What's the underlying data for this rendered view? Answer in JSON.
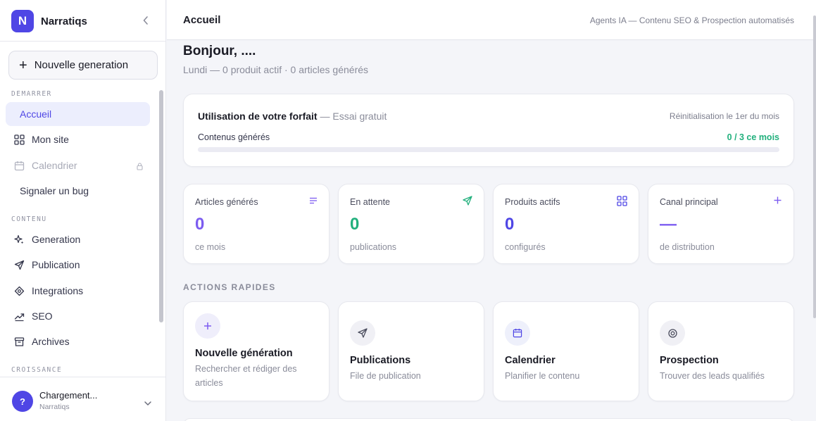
{
  "app": {
    "name": "Narratiqs",
    "logo_letter": "N",
    "accent": "#4f46e5"
  },
  "sidebar": {
    "new_button": "Nouvelle generation",
    "sections": [
      {
        "label": "DEMARRER"
      },
      {
        "label": "CONTENU"
      },
      {
        "label": "CROISSANCE"
      }
    ],
    "items": [
      {
        "label": "Accueil",
        "icon": "home",
        "active": true
      },
      {
        "label": "Mon site",
        "icon": "grid-icon"
      },
      {
        "label": "Calendrier",
        "icon": "calendar-icon",
        "locked": true
      },
      {
        "label": "Signaler un bug"
      },
      {
        "label": "Generation",
        "icon": "sparkle-icon"
      },
      {
        "label": "Publication",
        "icon": "send-icon"
      },
      {
        "label": "Integrations",
        "icon": "plug-icon"
      },
      {
        "label": "SEO",
        "icon": "trend-icon"
      },
      {
        "label": "Archives",
        "icon": "archive-icon"
      }
    ],
    "user": {
      "avatar": "?",
      "name": "Chargement...",
      "org": "Narratiqs"
    }
  },
  "header": {
    "title": "Accueil",
    "subtitle": "Agents IA — Contenu SEO & Prospection automatisés"
  },
  "main": {
    "greeting": "Bonjour, ....",
    "greeting_sub": "Lundi — 0 produit actif · 0 articles générés",
    "plan": {
      "title": "Utilisation de votre forfait",
      "plan_name": "— Essai gratuit",
      "reset": "Réinitialisation le 1er du mois",
      "label": "Contenus générés",
      "count": "0 / 3 ce mois",
      "used": 0,
      "limit": 3
    },
    "stats": [
      {
        "label": "Articles générés",
        "value": "0",
        "sub": "ce mois",
        "color": "#7c5cf0",
        "icon": "lines-icon"
      },
      {
        "label": "En attente",
        "value": "0",
        "sub": "publications",
        "color": "#22b07d",
        "icon": "send-icon"
      },
      {
        "label": "Produits actifs",
        "value": "0",
        "sub": "configurés",
        "color": "#4f46e5",
        "icon": "grid-icon"
      },
      {
        "label": "Canal principal",
        "value": "—",
        "sub": "de distribution",
        "color": "#7c5cf0",
        "icon": "plus-icon"
      }
    ],
    "actions_heading": "ACTIONS RAPIDES",
    "actions": [
      {
        "title": "Nouvelle génération",
        "desc": "Rechercher et rédiger des articles",
        "icon": "plus-icon"
      },
      {
        "title": "Publications",
        "desc": "File de publication",
        "icon": "send-icon"
      },
      {
        "title": "Calendrier",
        "desc": "Planifier le contenu",
        "icon": "calendar-icon"
      },
      {
        "title": "Prospection",
        "desc": "Trouver des leads qualifiés",
        "icon": "target-icon"
      }
    ]
  }
}
